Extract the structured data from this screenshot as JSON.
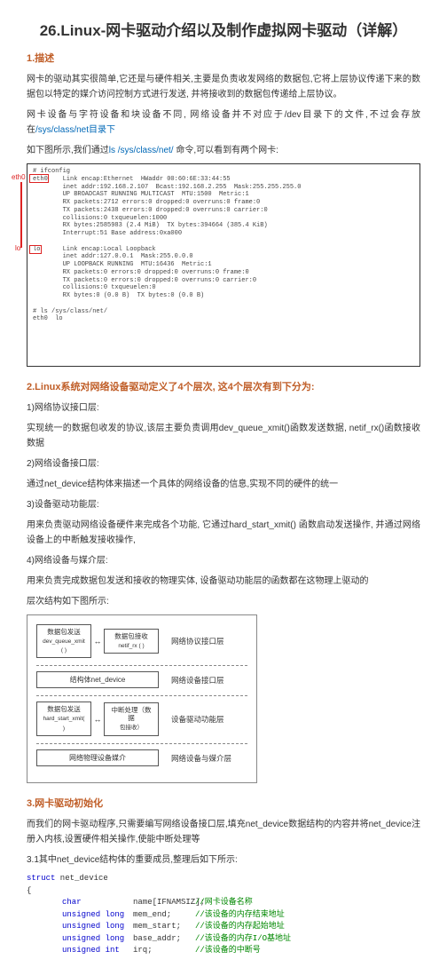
{
  "title": "26.Linux-网卡驱动介绍以及制作虚拟网卡驱动（详解）",
  "s1": {
    "heading": "1.描述",
    "p1": "网卡的驱动其实很简单,它还是与硬件相关,主要是负责收发网络的数据包,它将上层协议传递下来的数据包以特定的媒介访问控制方式进行发送,  并将接收到的数据包传递给上层协议。",
    "p2a": "网卡设备与字符设备和块设备不同,  网络设备并不对应于/dev目录下的文件,不过会存放在",
    "p2b": "/sys/class/net目录下",
    "p3a": "如下图所示,我们通过",
    "p3b": "ls /sys/class/net/",
    "p3c": " 命令,可以看到有两个网卡:"
  },
  "term": "# ifconfig\neth0    Link encap:Ethernet  HWaddr 00:60:6E:33:44:55\n        inet addr:192.168.2.107  Bcast:192.168.2.255  Mask:255.255.255.0\n        UP BROADCAST RUNNING MULTICAST  MTU:1500  Metric:1\n        RX packets:2712 errors:0 dropped:0 overruns:0 frame:0\n        TX packets:2438 errors:0 dropped:0 overruns:0 carrier:0\n        collisions:0 txqueuelen:1000\n        RX bytes:2585983 (2.4 MiB)  TX bytes:394664 (385.4 KiB)\n        Interrupt:51 Base address:0xa000\n\nlo      Link encap:Local Loopback\n        inet addr:127.0.0.1  Mask:255.0.0.0\n        UP LOOPBACK RUNNING  MTU:16436  Metric:1\n        RX packets:0 errors:0 dropped:0 overruns:0 frame:0\n        TX packets:0 errors:0 dropped:0 overruns:0 carrier:0\n        collisions:0 txqueuelen:0\n        RX bytes:0 (0.0 B)  TX bytes:0 (0.0 B)\n\n# ls /sys/class/net/\neth0  lo",
  "s2": {
    "heading": "2.Linux系统对网络设备驱动定义了4个层次,  这4个层次有到下分为:",
    "h1": "1)网络协议接口层:",
    "p1": "实现统一的数据包收发的协议,该层主要负责调用dev_queue_xmit()函数发送数据,  netif_rx()函数接收数据",
    "h2": "2)网络设备接口层:",
    "p2": "通过net_device结构体来描述一个具体的网络设备的信息,实现不同的硬件的统一",
    "h3": "3)设备驱动功能层:",
    "p3": "用来负责驱动网络设备硬件来完成各个功能, 它通过hard_start_xmit() 函数启动发送操作,  并通过网络设备上的中断触发接收操作,",
    "h4": "4)网络设备与媒介层:",
    "p4": "用来负责完成数据包发送和接收的物理实体, 设备驱动功能层的函数都在这物理上驱动的",
    "p5": "层次结构如下图所示:"
  },
  "diagram": {
    "b1a": "数据包发送",
    "b1b": "dev_queue_xmit ( )",
    "b2a": "数据包接收",
    "b2b": "netif_rx ( )",
    "l1": "网络协议接口层",
    "mid": "结构体net_device",
    "l2": "网络设备接口层",
    "b3a": "数据包发送",
    "b3b": "hard_start_xmit( )",
    "b4a": "中断处理（数据",
    "b4b": "包接收）",
    "l3": "设备驱动功能层",
    "bottom": "网络物理设备媒介",
    "l4": "网络设备与媒介层"
  },
  "s3": {
    "heading": "3.网卡驱动初始化",
    "p1": "而我们的网卡驱动程序,只需要编写网络设备接口层,填充net_device数据结构的内容并将net_device注册入内核,设置硬件相关操作,使能中断处理等",
    "p2": "3.1其中net_device结构体的重要成员,整理后如下所示:"
  },
  "code": {
    "l1a": "struct",
    "l1b": " net_device",
    "l2": "{",
    "r1t": "char",
    "r1n": "name[IFNAMSIZ];",
    "r1c": "//网卡设备名称",
    "r2t": "unsigned long",
    "r2n": "mem_end;",
    "r2c": "//该设备的内存结束地址",
    "r3t": "unsigned long",
    "r3n": "mem_start;",
    "r3c": "//该设备的内存起始地址",
    "r4t": "unsigned long",
    "r4n": "base_addr;",
    "r4c": "//该设备的内存I/O基地址",
    "r5t": "unsigned int",
    "r5n": "irq;",
    "r5c": "//该设备的中断号"
  }
}
